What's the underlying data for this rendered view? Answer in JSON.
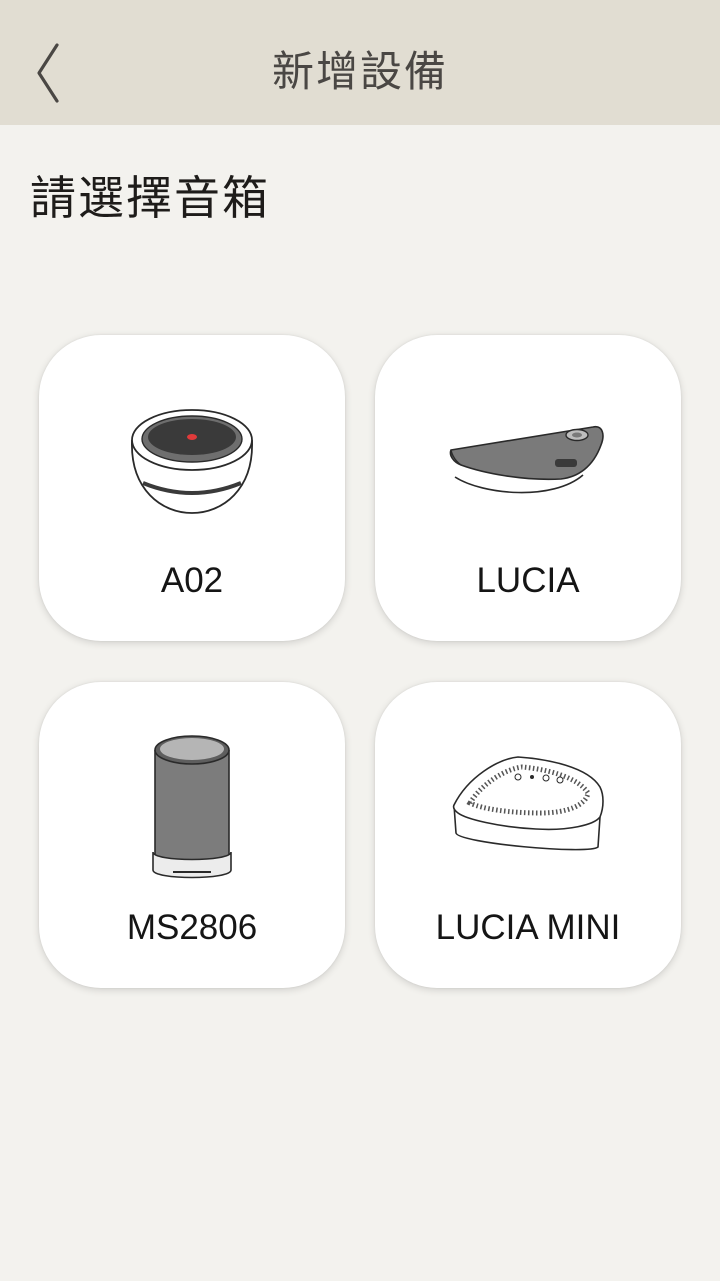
{
  "header": {
    "title": "新增設備",
    "back_icon": "chevron-left-icon"
  },
  "subtitle": "請選擇音箱",
  "devices": [
    {
      "label": "A02",
      "icon": "round-speaker-icon"
    },
    {
      "label": "LUCIA",
      "icon": "wedge-speaker-icon"
    },
    {
      "label": "MS2806",
      "icon": "cylinder-speaker-icon"
    },
    {
      "label": "LUCIA MINI",
      "icon": "square-speaker-icon"
    }
  ],
  "colors": {
    "header_bg": "#e1ddd2",
    "page_bg": "#f3f2ee",
    "card_bg": "#ffffff",
    "title_text": "#4a4744",
    "accent_led": "#e03a3a"
  }
}
